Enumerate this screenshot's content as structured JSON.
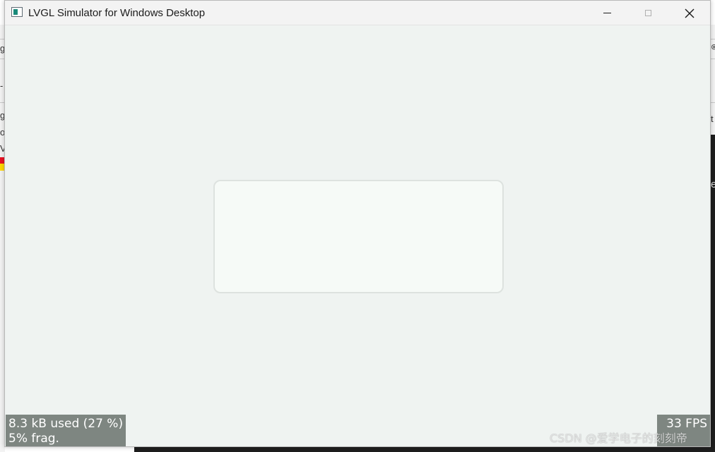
{
  "window": {
    "title": "LVGL Simulator for Windows Desktop",
    "icon": "app-window-icon"
  },
  "titlebar_buttons": {
    "minimize_icon": "minimize-icon",
    "maximize_icon": "maximize-icon",
    "close_icon": "close-icon",
    "close_glyph": "✕"
  },
  "overlays": {
    "memory": {
      "used": "8.3 kB used (27 %)",
      "frag": "5% frag."
    },
    "fps": {
      "value": "33 FPS"
    }
  },
  "background": {
    "left_glyphs": [
      "g",
      "-",
      "g",
      "oj",
      "V"
    ],
    "right_glyphs": [
      "⊗",
      "t",
      "e"
    ]
  },
  "watermark": {
    "text": "CSDN @爱学电子的刻刻帝"
  },
  "colors": {
    "client_bg": "#eff3f1",
    "card_bg": "#f6faf7",
    "card_border": "#dde2df",
    "overlay_bg": "#6e7671"
  }
}
